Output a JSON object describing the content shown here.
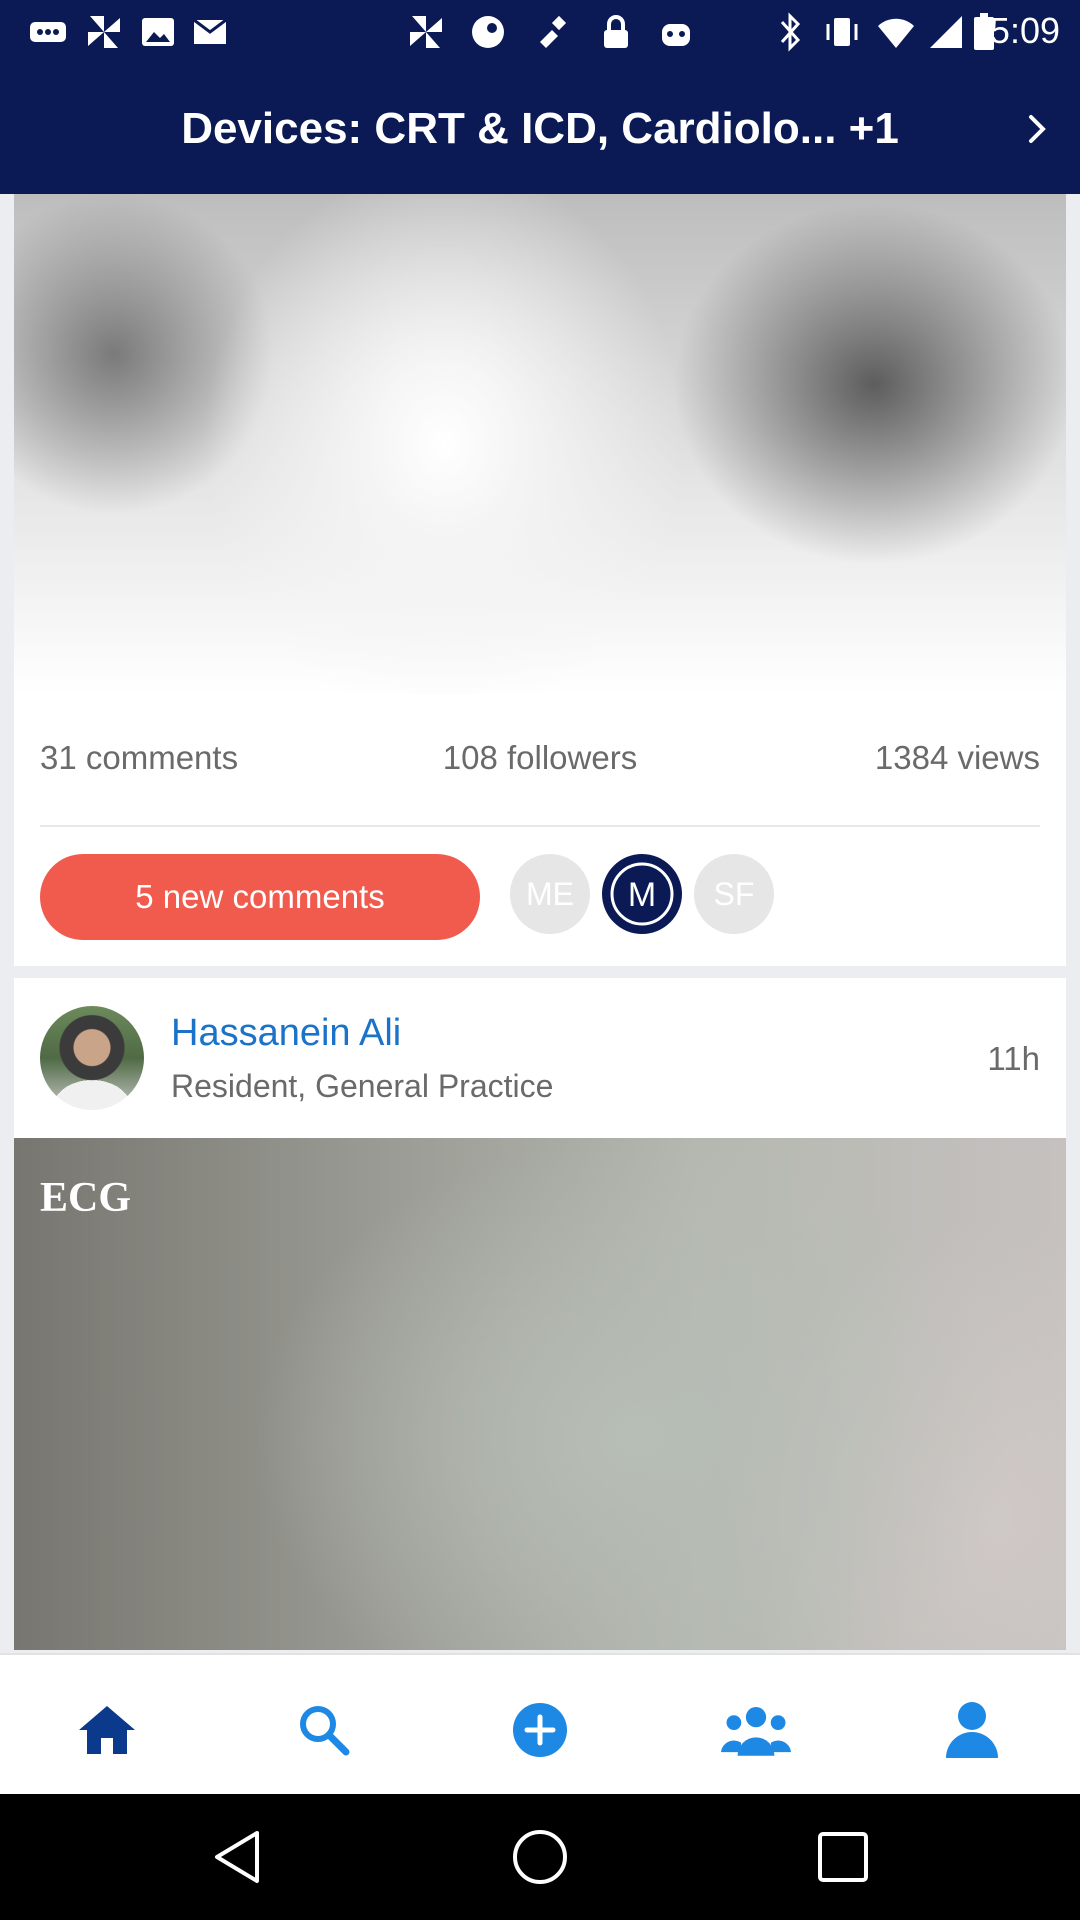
{
  "status_bar": {
    "time": "5:09",
    "icons": [
      "more-icon",
      "pinwheel-icon",
      "photo-icon",
      "mail-icon",
      "pinwheel-icon",
      "steam-icon",
      "satellite-fake-gps-icon",
      "lock-icon",
      "robot-icon",
      "bluetooth-icon",
      "vibrate-icon",
      "wifi-icon",
      "signal-icon",
      "battery-icon"
    ]
  },
  "header": {
    "title": "Devices: CRT & ICD, Cardiolo... +1",
    "next_icon": "chevron-right-icon"
  },
  "topic_card": {
    "stats": {
      "comments": "31 comments",
      "followers": "108 followers",
      "views": "1384 views"
    },
    "new_comments_label": "5 new comments",
    "avatars": [
      "ME",
      "M",
      "SF"
    ]
  },
  "post": {
    "author_name": "Hassanein Ali",
    "author_role": "Resident, General Practice",
    "time": "11h",
    "title": "ECG"
  },
  "bottom_nav": {
    "items": [
      "home-icon",
      "search-icon",
      "add-icon",
      "groups-icon",
      "profile-icon"
    ]
  },
  "colors": {
    "header_bg": "#0b1a55",
    "accent_blue": "#1a73c9",
    "new_comments_red": "#f15b4e",
    "nav_icon_blue": "#1e88e5"
  }
}
